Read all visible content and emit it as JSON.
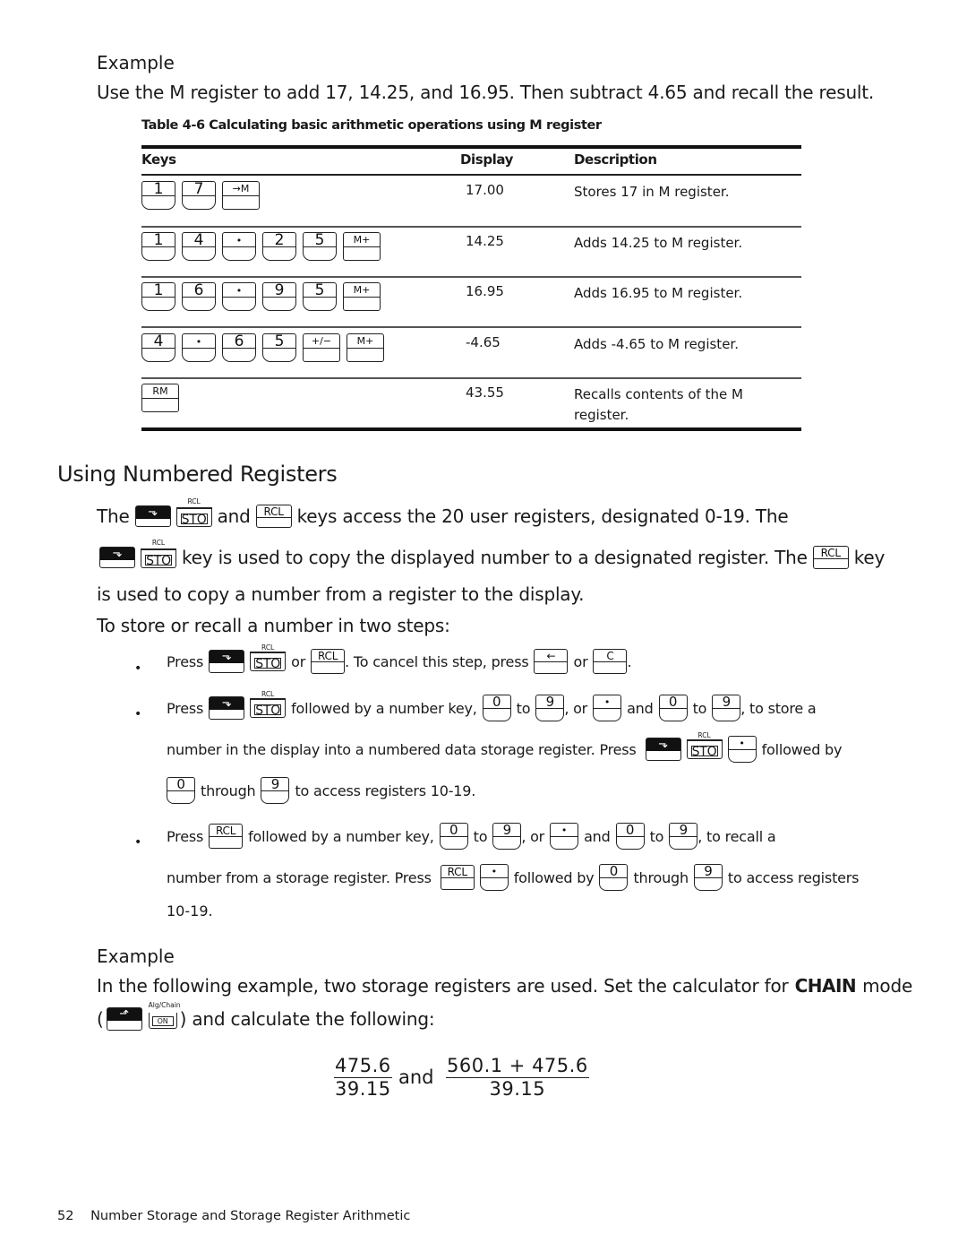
{
  "example1": {
    "heading": "Example",
    "intro": "Use the M register to add 17, 14.25, and 16.95. Then subtract 4.65 and recall the result."
  },
  "table": {
    "caption": "Table 4-6  Calculating basic arithmetic operations using M register",
    "headers": {
      "keys": "Keys",
      "display": "Display",
      "description": "Description"
    },
    "rows": [
      {
        "keys": [
          "1",
          "7",
          "→M"
        ],
        "display": "17.00",
        "description": "Stores 17 in M register."
      },
      {
        "keys": [
          "1",
          "4",
          "•",
          "2",
          "5",
          "M+"
        ],
        "display": "14.25",
        "description": "Adds 14.25 to M register."
      },
      {
        "keys": [
          "1",
          "6",
          "•",
          "9",
          "5",
          "M+"
        ],
        "display": "16.95",
        "description": "Adds 16.95 to M register."
      },
      {
        "keys": [
          "4",
          "•",
          "6",
          "5",
          "+/−",
          "M+"
        ],
        "display": "-4.65",
        "description": "Adds -4.65 to M register."
      },
      {
        "keys": [
          "RM"
        ],
        "display": "43.55",
        "description": "Recalls contents of the M register."
      }
    ]
  },
  "section": {
    "title": "Using Numbered Registers",
    "p1_a": "The",
    "p1_b": "and",
    "p1_c": "keys access the 20 user registers, designated 0-19. The",
    "p2_a": "key is used to copy the displayed number to a designated register. The",
    "p2_b": "key",
    "p3": "is used to copy a number from a register to the display.",
    "p4": "To store or recall a number in two steps:"
  },
  "keys": {
    "shift_down": "⬎",
    "shift_up": "⬏",
    "sto": "STO",
    "rcl_small": "RCL",
    "rcl": "RCL",
    "backspace": "←",
    "clear": "C",
    "zero": "0",
    "nine": "9",
    "dot": "•",
    "alg_chain": "Alg/Chain",
    "on": "ON"
  },
  "bullets": {
    "marker": "•",
    "b1_a": "Press",
    "b1_b": "or",
    "b1_c": ". To cancel this step, press",
    "b1_d": "or",
    "b1_e": ".",
    "b2_a": "Press",
    "b2_b": "followed by a number key,",
    "b2_c": "to",
    "b2_d": ", or",
    "b2_e": "and",
    "b2_f": "to",
    "b2_g": ", to store a",
    "b2_h": "number in the display into a numbered data storage register. Press",
    "b2_i": "followed by",
    "b2_j": "through",
    "b2_k": "to access registers 10-19.",
    "b3_a": "Press",
    "b3_b": "followed by a number key,",
    "b3_c": "to",
    "b3_d": ", or",
    "b3_e": "and",
    "b3_f": "to",
    "b3_g": ", to recall a",
    "b3_h": "number from a storage register. Press",
    "b3_i": "followed by",
    "b3_j": "through",
    "b3_k": "to access registers",
    "b3_l": "10-19."
  },
  "example2": {
    "heading": "Example",
    "p1_a": "In the following example, two storage registers are used. Set the calculator for",
    "p1_bold": "CHAIN",
    "p1_b": "mode",
    "p2_open": "(",
    "p2_b": ") and calculate the following:",
    "frac1_num": "475.6",
    "frac1_den": "39.15",
    "and": "and",
    "frac2_num": "560.1 + 475.6",
    "frac2_den": "39.15"
  },
  "footer": {
    "page_number": "52",
    "chapter": "Number Storage and Storage Register Arithmetic"
  }
}
